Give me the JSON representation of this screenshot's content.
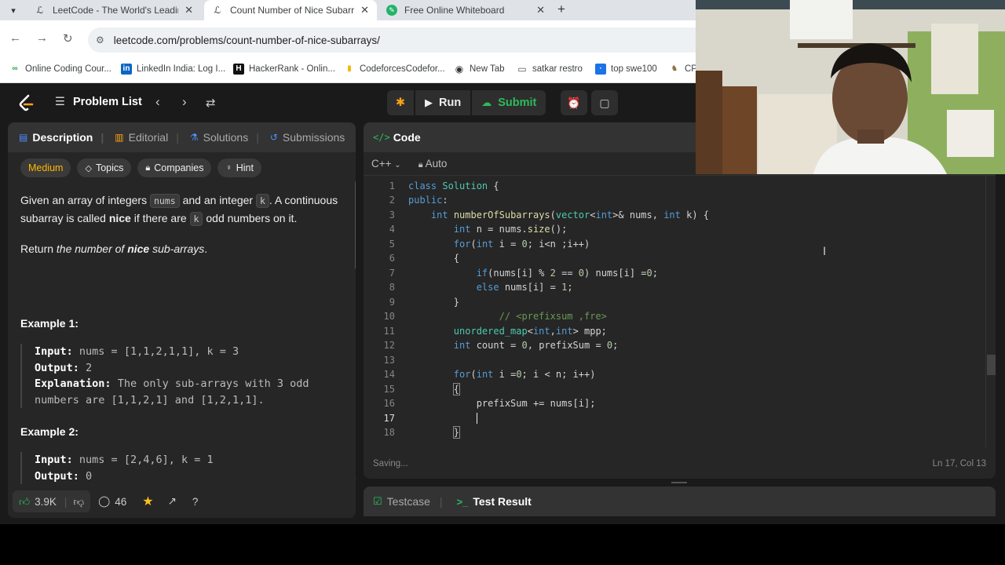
{
  "browser": {
    "tabs": [
      {
        "title": "LeetCode - The World's Leading",
        "favicon": "leetcode-icon",
        "active": false
      },
      {
        "title": "Count Number of Nice Subarra",
        "favicon": "leetcode-icon",
        "active": true
      },
      {
        "title": "Free Online Whiteboard",
        "favicon": "whiteboard-icon",
        "active": false
      }
    ],
    "new_tab": "+",
    "url": "leetcode.com/problems/count-number-of-nice-subarrays/",
    "bookmarks": [
      {
        "label": "Online Coding Cour...",
        "icon": "coding-icon"
      },
      {
        "label": "LinkedIn India: Log I...",
        "icon": "linkedin-icon"
      },
      {
        "label": "HackerRank - Onlin...",
        "icon": "hackerrank-icon"
      },
      {
        "label": "CodeforcesCodefor...",
        "icon": "codeforces-icon"
      },
      {
        "label": "New Tab",
        "icon": "globe-icon"
      },
      {
        "label": "satkar restro",
        "icon": "folder-icon"
      },
      {
        "label": "top swe100",
        "icon": "bookmark-icon"
      },
      {
        "label": "CP",
        "icon": "cp-icon"
      }
    ]
  },
  "nav": {
    "problem_list": "Problem List",
    "run": "Run",
    "submit": "Submit"
  },
  "left_panel": {
    "tabs": [
      "Description",
      "Editorial",
      "Solutions",
      "Submissions"
    ],
    "difficulty": "Medium",
    "chips": [
      "Topics",
      "Companies",
      "Hint"
    ],
    "desc_p1_a": "Given an array of integers ",
    "desc_code_nums": "nums",
    "desc_p1_b": " and an integer ",
    "desc_code_k": "k",
    "desc_p1_c": ". A continuous subarray is called ",
    "desc_nice": "nice",
    "desc_p1_d": " if there are ",
    "desc_p1_e": " odd numbers on it.",
    "desc_p2_a": "Return ",
    "desc_p2_b": "the number of ",
    "desc_p2_c": "nice",
    "desc_p2_d": " sub-arrays",
    "desc_p2_e": ".",
    "example1_title": "Example 1:",
    "ex1": {
      "input_label": "Input:",
      "input": "nums = [1,1,2,1,1], k = 3",
      "output_label": "Output:",
      "output": "2",
      "expl_label": "Explanation:",
      "expl_1": "The only sub-arrays with 3 odd",
      "expl_2": "numbers are [1,1,2,1] and [1,2,1,1]."
    },
    "example2_title": "Example 2:",
    "ex2": {
      "input_label": "Input:",
      "input": "nums = [2,4,6], k = 1",
      "output_label": "Output:",
      "output": "0"
    },
    "footer": {
      "likes": "3.9K",
      "comments": "46"
    }
  },
  "code_panel": {
    "title": "Code",
    "language": "C++",
    "lock_label": "Auto",
    "status_left": "Saving...",
    "status_right": "Ln 17, Col 13"
  },
  "bottom_panel": {
    "tabs": [
      "Testcase",
      "Test Result"
    ]
  },
  "colors": {
    "accent": "#ffa116",
    "green": "#2cbb5d",
    "medium": "#ffb800"
  }
}
